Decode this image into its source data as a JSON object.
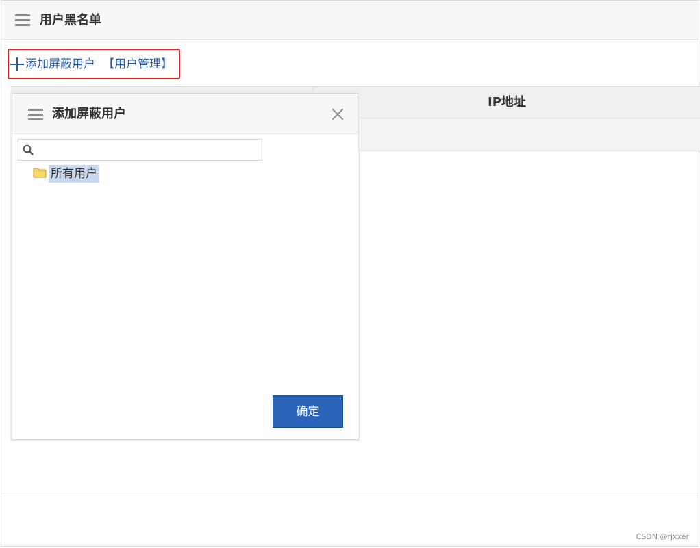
{
  "page": {
    "title": "用户黑名单"
  },
  "toolbar": {
    "add_blocked_user_label": "添加屏蔽用户",
    "user_management_label": "【用户管理】"
  },
  "table": {
    "columns": [
      "",
      "IP地址"
    ]
  },
  "dialog": {
    "title": "添加屏蔽用户",
    "search": {
      "value": "",
      "placeholder": ""
    },
    "tree": {
      "root_label": "所有用户"
    },
    "confirm_label": "确定"
  },
  "watermark": "CSDN @rjxxer",
  "colors": {
    "accent": "#2a63b8",
    "link": "#2a5da8",
    "highlight_border": "#e8231f",
    "selected_node": "#c9d8ee"
  },
  "icons": {
    "header_menu": "menu-icon",
    "toolbar_add": "plus-icon",
    "dialog_menu": "menu-icon",
    "dialog_close": "close-icon",
    "search": "search-icon",
    "tree_folder": "folder-icon"
  }
}
